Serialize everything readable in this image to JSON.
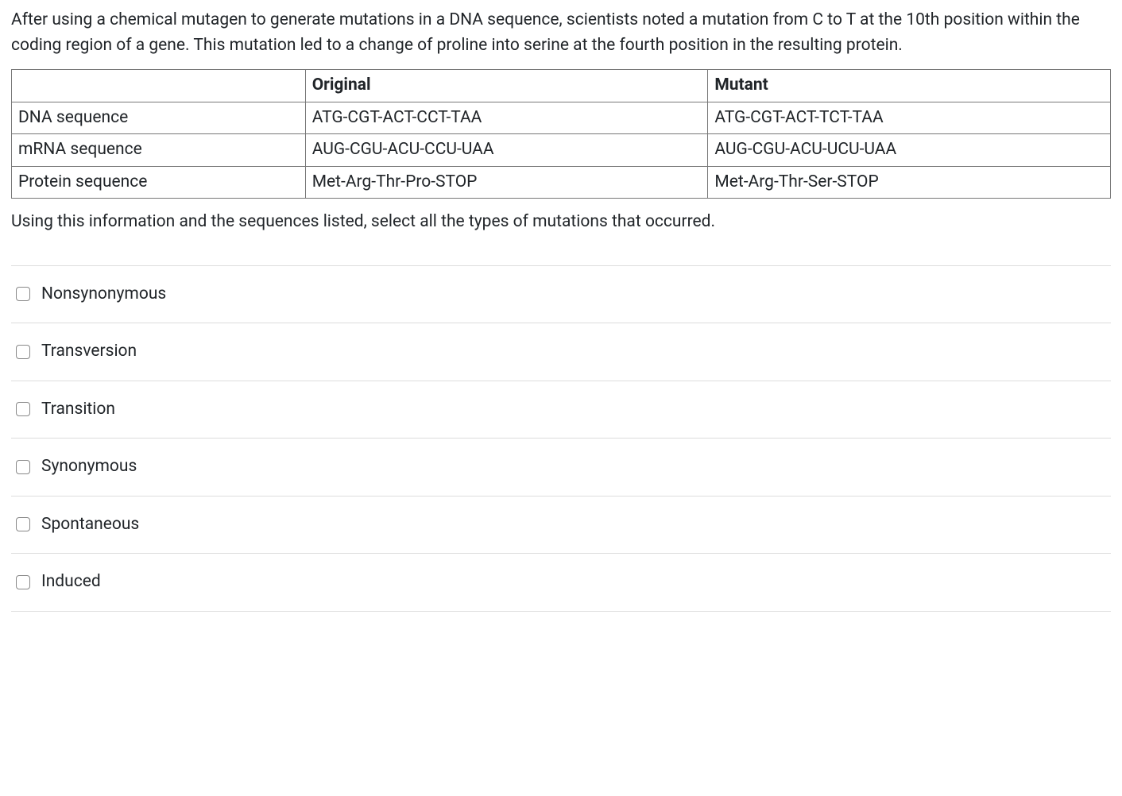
{
  "intro": "After using a chemical mutagen to generate mutations in a DNA sequence, scientists noted a mutation from C to T at the 10th position within the coding region of a gene. This mutation led to a change of proline into serine at the fourth position in the resulting protein.",
  "table": {
    "headers": {
      "blank": "",
      "original": "Original",
      "mutant": "Mutant"
    },
    "rows": [
      {
        "label": "DNA sequence",
        "original": "ATG-CGT-ACT-CCT-TAA",
        "mutant": "ATG-CGT-ACT-TCT-TAA"
      },
      {
        "label": "mRNA sequence",
        "original": "AUG-CGU-ACU-CCU-UAA",
        "mutant": "AUG-CGU-ACU-UCU-UAA"
      },
      {
        "label": "Protein sequence",
        "original": "Met-Arg-Thr-Pro-STOP",
        "mutant": "Met-Arg-Thr-Ser-STOP"
      }
    ]
  },
  "question": "Using this information and the sequences listed, select all the types of mutations that occurred.",
  "options": [
    "Nonsynonymous",
    "Transversion",
    "Transition",
    "Synonymous",
    "Spontaneous",
    "Induced"
  ]
}
